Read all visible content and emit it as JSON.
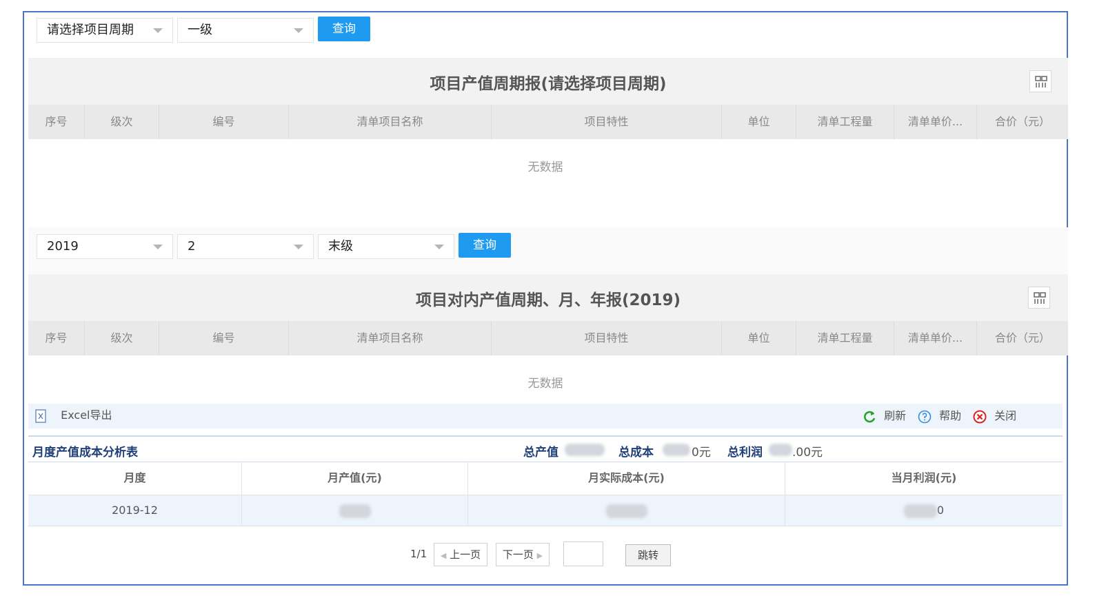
{
  "filter1": {
    "cycle_select": "请选择项目周期",
    "level_select": "一级",
    "query_label": "查询"
  },
  "table1": {
    "title": "项目产值周期报(请选择项目周期)",
    "headers": [
      "序号",
      "级次",
      "编号",
      "清单项目名称",
      "项目特性",
      "单位",
      "清单工程量",
      "清单单价...",
      "合价（元）"
    ],
    "empty_text": "无数据"
  },
  "filter2": {
    "year_select": "2019",
    "period_select": "2",
    "level_select": "末级",
    "query_label": "查询"
  },
  "table2": {
    "title": "项目对内产值周期、月、年报(2019)",
    "headers": [
      "序号",
      "级次",
      "编号",
      "清单项目名称",
      "项目特性",
      "单位",
      "清单工程量",
      "清单单价...",
      "合价（元）"
    ],
    "empty_text": "无数据"
  },
  "toolbar": {
    "excel_label": "Excel导出",
    "refresh_label": "刷新",
    "help_label": "帮助",
    "close_label": "关闭"
  },
  "monthly": {
    "title": "月度产值成本分析表",
    "total_output_label": "总产值",
    "total_cost_label": "总成本",
    "total_cost_suffix": "0元",
    "total_profit_label": "总利润",
    "total_profit_suffix": ".00元",
    "headers": [
      "月度",
      "月产值(元)",
      "月实际成本(元)",
      "当月利润(元)"
    ],
    "rows": [
      {
        "month": "2019-12",
        "profit_suffix": "0"
      }
    ]
  },
  "pager": {
    "page_info": "1/1",
    "prev_label": "上一页",
    "next_label": "下一页",
    "jump_label": "跳转"
  },
  "colors": {
    "frame": "#4b74c9",
    "button": "#1e9bf0",
    "refresh_icon": "#2aa22a",
    "help_icon": "#3a8ad9",
    "close_icon": "#d9231e",
    "summary_title": "#1f3f77"
  }
}
